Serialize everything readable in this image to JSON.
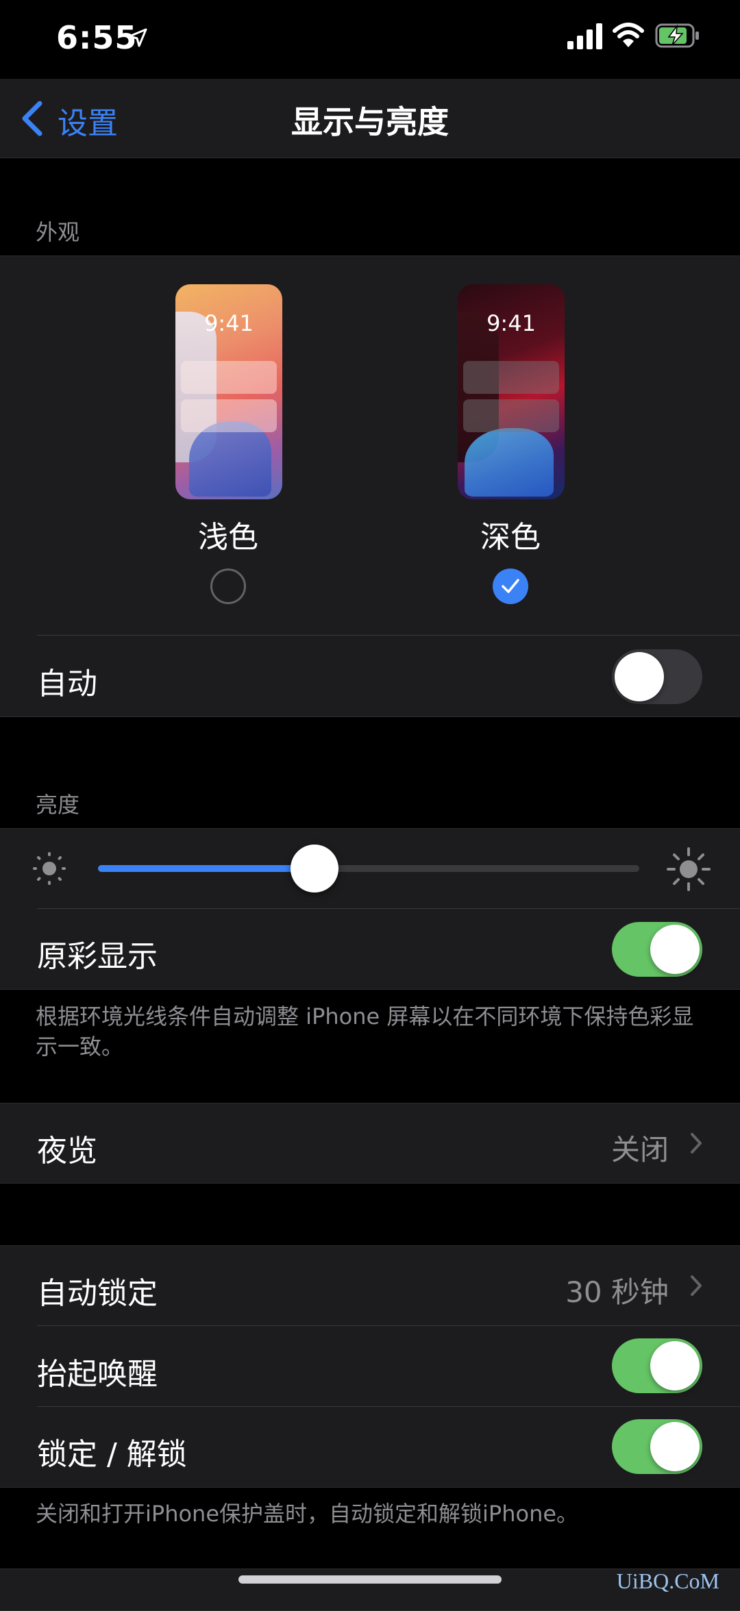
{
  "status": {
    "time": "6:55"
  },
  "nav": {
    "back_label": "设置",
    "title": "显示与亮度"
  },
  "appearance": {
    "header": "外观",
    "preview_time": "9:41",
    "light_label": "浅色",
    "dark_label": "深色",
    "selected": "dark",
    "auto_label": "自动",
    "auto_on": false
  },
  "brightness": {
    "header": "亮度",
    "level_fraction": 0.4,
    "true_tone_label": "原彩显示",
    "true_tone_on": true,
    "true_tone_footer": "根据环境光线条件自动调整 iPhone 屏幕以在不同环境下保持色彩显示一致。"
  },
  "night_shift": {
    "label": "夜览",
    "value": "关闭"
  },
  "lock": {
    "auto_lock_label": "自动锁定",
    "auto_lock_value": "30 秒钟",
    "raise_wake_label": "抬起唤醒",
    "raise_wake_on": true,
    "lock_unlock_label": "锁定 / 解锁",
    "lock_unlock_on": true,
    "footer": "关闭和打开iPhone保护盖时，自动锁定和解锁iPhone。"
  },
  "watermark": "UiBQ.CoM",
  "colors": {
    "accent": "#3b82f6",
    "toggle_on": "#65c466",
    "toggle_off": "#39393d"
  },
  "icons": [
    "location-arrow-icon",
    "signal-icon",
    "wifi-icon",
    "battery-charging-icon",
    "back-chevron-icon",
    "chevron-right-icon",
    "sun-small-icon",
    "sun-large-icon",
    "checkmark-icon"
  ]
}
